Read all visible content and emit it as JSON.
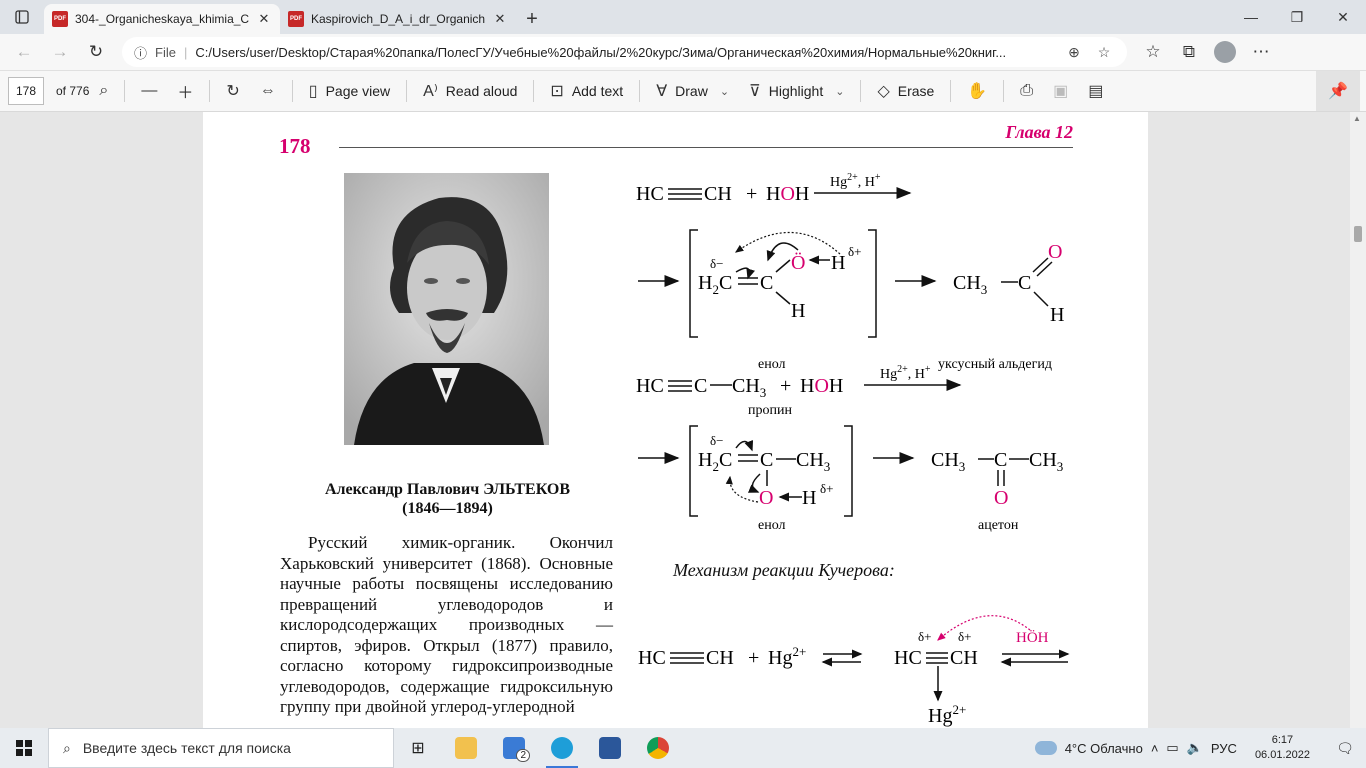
{
  "tabs": [
    {
      "title": "304-_Organicheskaya_khimia_Ch",
      "active": true
    },
    {
      "title": "Kaspirovich_D_A_i_dr_Organiche",
      "active": false
    }
  ],
  "tab_icon_text": "PDF",
  "address": {
    "file_label": "File",
    "url": "C:/Users/user/Desktop/Старая%20папка/ПолесГУ/Учебные%20файлы/2%20курс/Зима/Органическая%20химия/Нормальные%20книг..."
  },
  "pdf_toolbar": {
    "page_current": "178",
    "page_total": "of 776",
    "page_view": "Page view",
    "read_aloud": "Read aloud",
    "add_text": "Add text",
    "draw": "Draw",
    "highlight": "Highlight",
    "erase": "Erase"
  },
  "page": {
    "number": "178",
    "chapter": "Глава 12",
    "person_name": "Александр Павлович ЭЛЬТЕКОВ",
    "person_years": "(1846—1894)",
    "bio": "Русский химик-органик. Окончил Харьковский университет (1868). Основные научные работы посвящены исследованию превращений углеводородов и кислородсодержащих производных — спиртов, эфиров. Открыл (1877) правило, согласно которому гидроксипроизводные углеводородов, содержащие гидроксильную группу при двойной углерод-углеродной",
    "mechanism_title": "Механизм реакции Кучерова:",
    "chem": {
      "hc": "HC",
      "ch": "CH",
      "c": "C",
      "h": "H",
      "o": "O",
      "o_lone": "Ö",
      "h2": "H",
      "ch3": "CH",
      "sub2": "2",
      "sub3": "3",
      "plus": "+",
      "hoh_h1": "H",
      "hoh_o": "O",
      "hoh_h2": "H",
      "hg_cat": "Hg",
      "sup_2plus": "2+",
      "h_cat": ", H",
      "sup_plus": "+",
      "delta_minus": "δ−",
      "delta_plus": "δ+",
      "enol": "енол",
      "acetaldehyde": "уксусный альдегид",
      "propyne": "пропин",
      "acetone": "ацетон",
      "hoh_mech": "HÖH"
    }
  },
  "taskbar": {
    "search_placeholder": "Введите здесь текст для поиска",
    "mail_badge": "2",
    "weather": "4°C  Облачно",
    "lang": "РУС",
    "time": "6:17",
    "date": "06.01.2022"
  }
}
